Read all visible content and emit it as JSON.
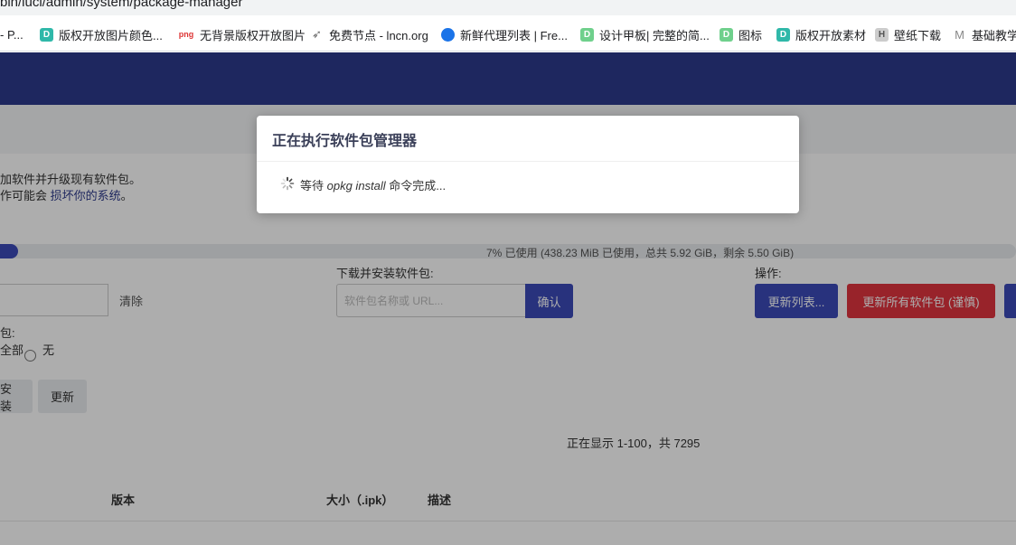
{
  "browser": {
    "url": "bin/luci/admin/system/package-manager",
    "bookmarks": [
      {
        "label": "- P...",
        "icon": "none"
      },
      {
        "label": "版权开放图片颜色...",
        "icon": "d-icon"
      },
      {
        "label": "无背景版权开放图片",
        "icon": "png-icon",
        "badge": "png"
      },
      {
        "label": "免费节点 - lncn.org",
        "icon": "send-icon"
      },
      {
        "label": "新鲜代理列表 | Fre...",
        "icon": "globe-icon"
      },
      {
        "label": "设计甲板| 完整的简...",
        "icon": "d-icon"
      },
      {
        "label": "图标",
        "icon": "d-icon"
      },
      {
        "label": "版权开放素材",
        "icon": "d-icon"
      },
      {
        "label": "壁纸下载",
        "icon": "wallpaper-icon"
      },
      {
        "label": "基础教学",
        "icon": "m-icon"
      }
    ]
  },
  "page": {
    "desc_line1": "加软件并升级现有软件包。",
    "desc_line2_prefix": "作可能会 ",
    "desc_line2_link": "损坏你的系统",
    "desc_line2_suffix": "。",
    "usage_text": "7% 已使用 (438.23 MiB 已使用，总共 5.92 GiB，剩余 5.50 GiB)",
    "usage_percent": 7,
    "filter": {
      "clear_label": "清除"
    },
    "download": {
      "label": "下载并安装软件包:",
      "placeholder": "软件包名称或 URL...",
      "confirm_label": "确认"
    },
    "actions": {
      "label": "操作:",
      "update_lists_label": "更新列表...",
      "upgrade_all_label": "更新所有软件包 (谨慎)"
    },
    "display": {
      "label": "包:",
      "option_all": "全部",
      "option_none": "无"
    },
    "tabs": {
      "install_label": "安装",
      "update_label": "更新"
    },
    "showing_text": "正在显示 1-100，共 7295",
    "table_headers": {
      "version": "版本",
      "size": "大小（.ipk）",
      "description": "描述"
    }
  },
  "modal": {
    "title": "正在执行软件包管理器",
    "msg_prefix": "等待 ",
    "msg_cmd": "opkg install",
    "msg_suffix": " 命令完成..."
  }
}
